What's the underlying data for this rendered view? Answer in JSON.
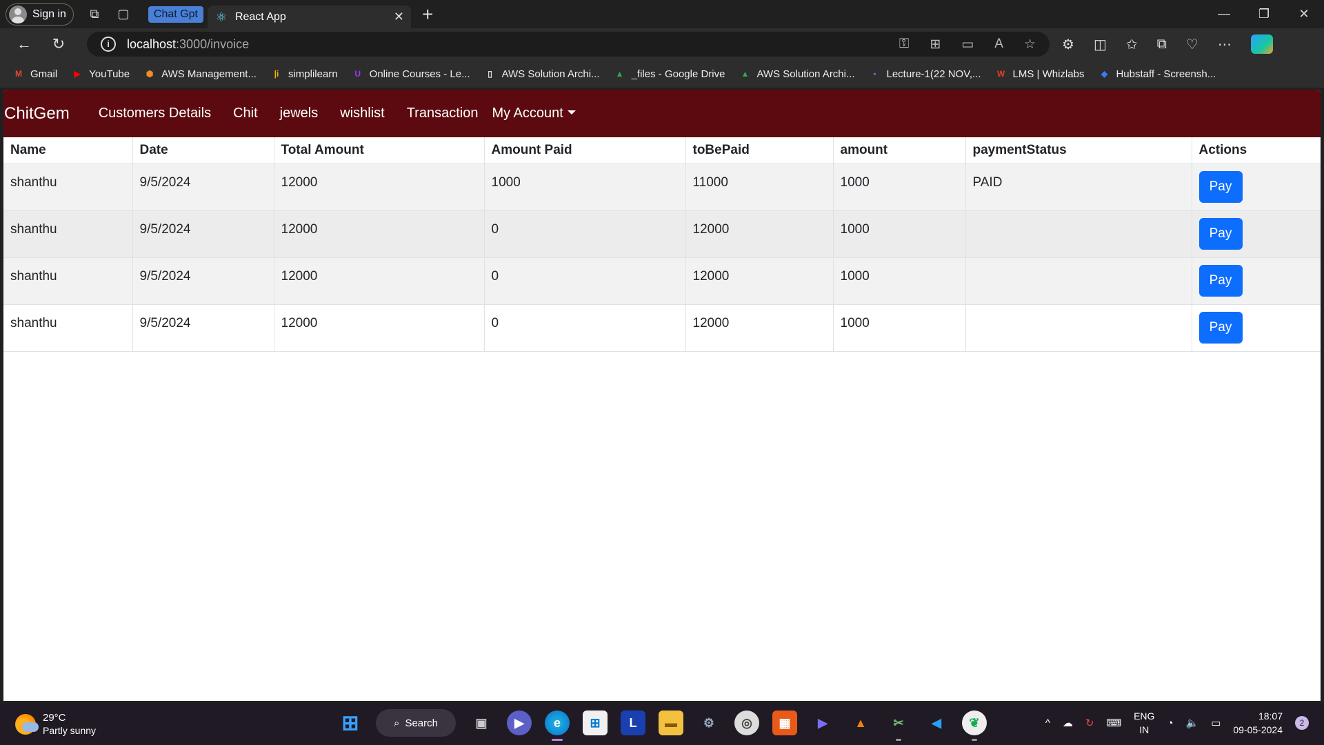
{
  "browser": {
    "sign_in": "Sign in",
    "tab_group": "Chat Gpt",
    "tab_title": "React App",
    "url_host": "localhost",
    "url_path": ":3000/invoice",
    "bookmarks": [
      {
        "label": "Gmail",
        "icon": "gmail-icon",
        "color": "#ea4335",
        "glyph": "M"
      },
      {
        "label": "YouTube",
        "icon": "youtube-icon",
        "color": "#ff0000",
        "glyph": "▶"
      },
      {
        "label": "AWS Management...",
        "icon": "aws-icon",
        "color": "#f28c28",
        "glyph": "⬢"
      },
      {
        "label": "simplilearn",
        "icon": "simplilearn-icon",
        "color": "#f4b400",
        "glyph": "|i"
      },
      {
        "label": "Online Courses - Le...",
        "icon": "udemy-icon",
        "color": "#a435f0",
        "glyph": "U"
      },
      {
        "label": "AWS Solution Archi...",
        "icon": "document-icon",
        "color": "#dddddd",
        "glyph": "▯"
      },
      {
        "label": "_files - Google Drive",
        "icon": "google-drive-icon",
        "color": "#34a853",
        "glyph": "▲"
      },
      {
        "label": "AWS Solution Archi...",
        "icon": "google-drive-icon",
        "color": "#34a853",
        "glyph": "▲"
      },
      {
        "label": "Lecture-1(22 NOV,...",
        "icon": "dot-icon",
        "color": "#4a6fd0",
        "glyph": "•"
      },
      {
        "label": "LMS | Whizlabs",
        "icon": "whizlabs-icon",
        "color": "#e04020",
        "glyph": "W"
      },
      {
        "label": "Hubstaff - Screensh...",
        "icon": "hubstaff-icon",
        "color": "#3a7bfd",
        "glyph": "◆"
      }
    ]
  },
  "app": {
    "brand": "ChitGem",
    "nav": [
      "Customers Details",
      "Chit",
      "jewels",
      "wishlist",
      "Transaction"
    ],
    "account_menu": "My Account"
  },
  "table": {
    "headers": [
      "Name",
      "Date",
      "Total Amount",
      "Amount Paid",
      "toBePaid",
      "amount",
      "paymentStatus",
      "Actions"
    ],
    "rows": [
      [
        "shanthu",
        "9/5/2024",
        "12000",
        "1000",
        "11000",
        "1000",
        "PAID"
      ],
      [
        "shanthu",
        "9/5/2024",
        "12000",
        "0",
        "12000",
        "1000",
        ""
      ],
      [
        "shanthu",
        "9/5/2024",
        "12000",
        "0",
        "12000",
        "1000",
        ""
      ],
      [
        "shanthu",
        "9/5/2024",
        "12000",
        "0",
        "12000",
        "1000",
        ""
      ]
    ],
    "action_label": "Pay"
  },
  "taskbar": {
    "temperature": "29°C",
    "weather": "Partly sunny",
    "search": "Search",
    "lang_top": "ENG",
    "lang_bottom": "IN",
    "time": "18:07",
    "date": "09-05-2024",
    "notifications": "2"
  },
  "colors": {
    "navbar": "#5c0a0f",
    "pay_button": "#0d6efd"
  }
}
